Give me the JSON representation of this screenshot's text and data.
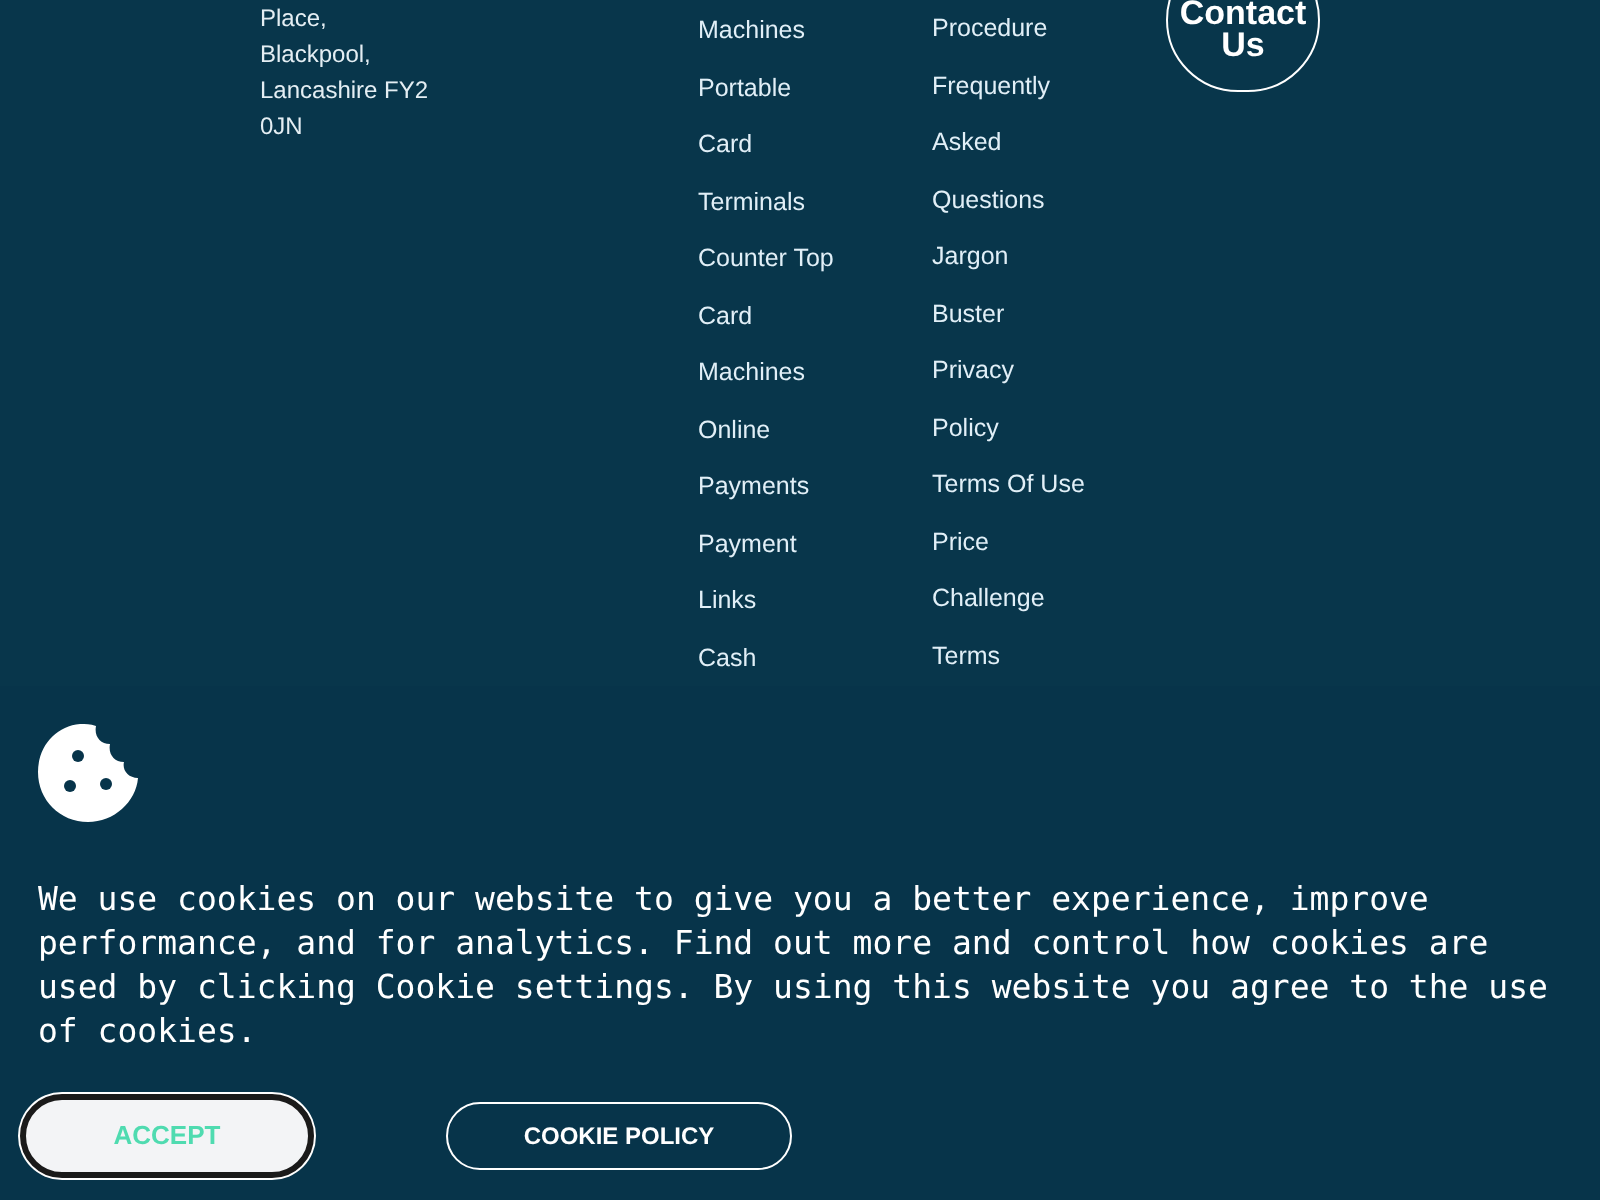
{
  "footer": {
    "address": [
      "Place,",
      "Blackpool,",
      "Lancashire FY2",
      "0JN"
    ],
    "link_columns": [
      [
        "Machines",
        "Portable",
        "Card",
        "Terminals",
        "Counter Top",
        "Card",
        "Machines",
        "Online",
        "Payments",
        "Payment",
        "Links",
        "Cash"
      ],
      [
        "Procedure",
        "Frequently",
        "Asked",
        "Questions",
        "Jargon",
        "Buster",
        "Privacy",
        "Policy",
        "Terms Of Use",
        "Price",
        "Challenge",
        "Terms"
      ]
    ],
    "contact_button": [
      "Contact",
      "Us"
    ]
  },
  "cookie_banner": {
    "message": "We use cookies on our website to give you a better experience, improve performance, and for analytics. Find out more and control how cookies are used by clicking Cookie settings. By using this website you agree to the use of cookies.",
    "buttons": [
      {
        "label": "ACCEPT",
        "kind": "primary"
      },
      {
        "label": "COOKIE POLICY",
        "kind": "outline"
      }
    ]
  }
}
